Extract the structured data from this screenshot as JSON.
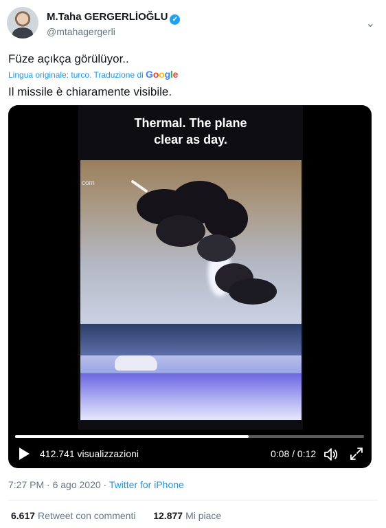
{
  "author": {
    "name": "M.Taha GERGERLİOĞLU",
    "handle": "@mtahagergerli",
    "verified": true
  },
  "tweet": {
    "text": "Füze açıkça görülüyor..",
    "translation_label": "Lingua originale: turco. Traduzione di",
    "translation_provider": "Google",
    "translated_text": "Il missile è chiaramente visibile."
  },
  "video": {
    "overlay_caption": "Thermal. The plane\nclear as day.",
    "watermark": "com",
    "views": "412.741 visualizzazioni",
    "time": "0:08 / 0:12",
    "progress": 0.67
  },
  "meta": {
    "time": "7:27 PM",
    "separator": " · ",
    "date": "6 ago 2020",
    "source": "Twitter for iPhone"
  },
  "stats": {
    "retweets_count": "6.617",
    "retweets_label": "Retweet con commenti",
    "likes_count": "12.877",
    "likes_label": "Mi piace"
  },
  "colors": {
    "link": "#1b95e0",
    "verified": "#1da1f2",
    "secondary_text": "#657786",
    "google_g": "#4285F4",
    "google_o1": "#EA4335",
    "google_o2": "#FBBC05",
    "google_l": "#34A853"
  }
}
